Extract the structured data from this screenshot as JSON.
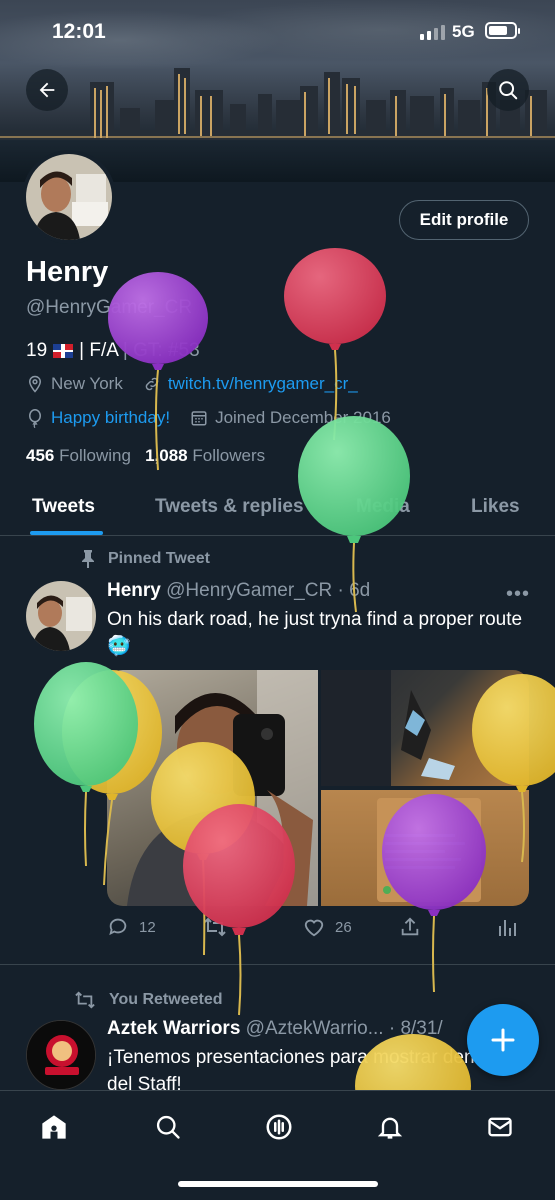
{
  "status_bar": {
    "time": "12:01",
    "network": "5G"
  },
  "profile": {
    "name": "Henry",
    "handle": "@HenryGamer_CR",
    "bio_prefix": "19",
    "bio_mid": "| F/A",
    "bio_suffix": "| GT: #53",
    "location": "New York",
    "link": "twitch.tv/henrygamer_cr_",
    "birthday": "Happy birthday!",
    "joined": "Joined December 2016",
    "following_count": "456",
    "following_label": "Following",
    "followers_count": "1,088",
    "followers_label": "Followers",
    "edit_label": "Edit profile"
  },
  "tabs": [
    {
      "label": "Tweets",
      "active": true
    },
    {
      "label": "Tweets & replies",
      "active": false
    },
    {
      "label": "Media",
      "active": false
    },
    {
      "label": "Likes",
      "active": false
    }
  ],
  "tweets": [
    {
      "context": "Pinned Tweet",
      "name": "Henry",
      "handle": "@HenryGamer_CR",
      "time": "6d",
      "text": "On his dark road, he just tryna find a proper route 🥶",
      "replies": "12",
      "retweets": "",
      "likes": "26"
    },
    {
      "context": "You Retweeted",
      "name": "Aztek Warriors",
      "handle": "@AztekWarrio...",
      "time": "8/31/",
      "text": "¡Tenemos  presentaciones para mostrar dentro del Staff!"
    }
  ],
  "icons": {
    "back": "back-arrow-icon",
    "search": "search-icon",
    "location": "location-pin-icon",
    "link": "link-icon",
    "balloon": "balloon-icon",
    "calendar": "calendar-icon",
    "pin": "pin-icon",
    "retweet": "retweet-icon",
    "compose": "plus-icon"
  },
  "colors": {
    "accent": "#1d9bf0",
    "background": "#15202b",
    "secondary_text": "#8b98a5",
    "divider": "#38444d"
  }
}
